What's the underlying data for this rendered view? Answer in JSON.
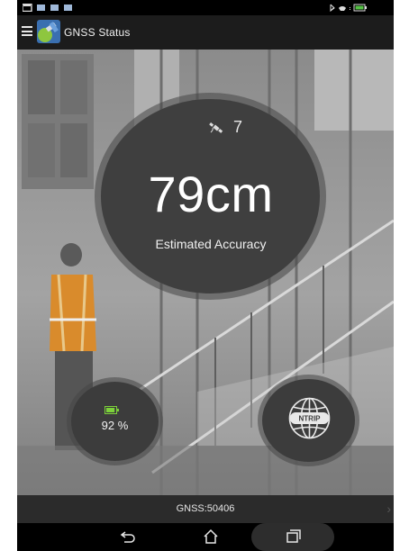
{
  "app": {
    "title": "GNSS Status"
  },
  "status": {
    "satellites": "7",
    "accuracy": "79cm",
    "accuracy_label": "Estimated Accuracy"
  },
  "battery": {
    "text": "92 %",
    "level": 0.92,
    "color": "#7cd13a"
  },
  "ntrip": {
    "label": "NTRIP"
  },
  "footer": {
    "gnss_text": "GNSS:50406"
  },
  "icons": {
    "menu": "hamburger-icon",
    "satellite": "satellite-icon",
    "battery": "battery-icon",
    "ntrip": "ntrip-globe-icon",
    "back": "back-icon",
    "home": "home-icon",
    "recent": "recent-apps-icon"
  }
}
